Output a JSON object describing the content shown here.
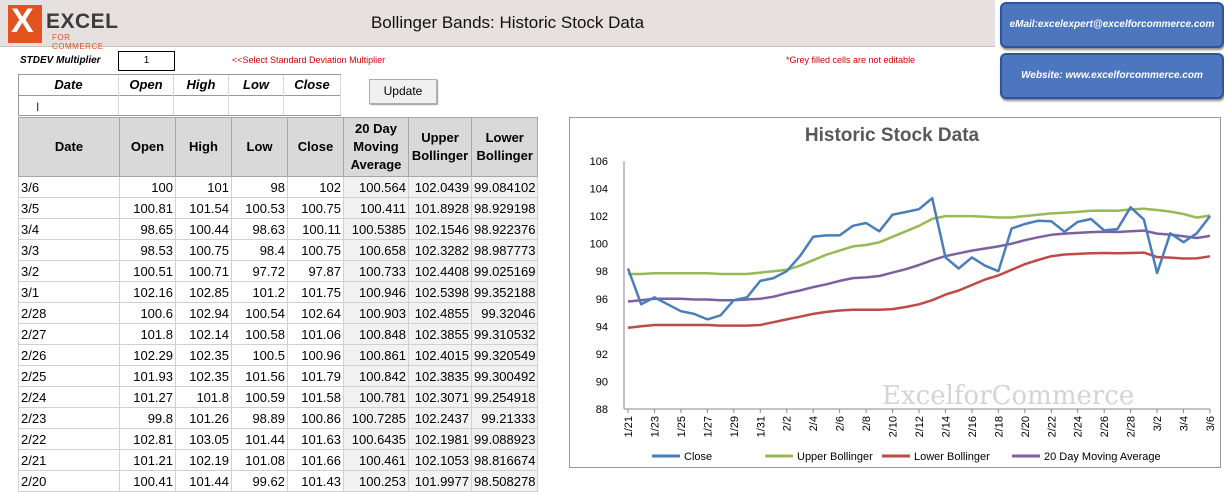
{
  "header": {
    "logo_word": "EXCEL",
    "logo_sub": "FOR COMMERCE",
    "logo_mark": "X",
    "title": "Bollinger Bands: Historic Stock Data",
    "email_button": "eMail:excelexpert@excelforcommerce.com",
    "website_button": "Website: www.excelforcommerce.com"
  },
  "controls": {
    "stdev_label": "STDEV Multiplier",
    "stdev_value": "1",
    "stdev_hint": "<<Select Standard Deviation Multiplier",
    "grey_note": "*Grey filled cells are not editable",
    "update_label": "Update",
    "cursor_glyph": "I"
  },
  "entry": {
    "headers": [
      "Date",
      "Open",
      "High",
      "Low",
      "Close"
    ]
  },
  "table": {
    "headers": [
      "Date",
      "Open",
      "High",
      "Low",
      "Close",
      "20 Day Moving Average",
      "Upper Bollinger",
      "Lower Bollinger"
    ],
    "rows": [
      [
        "3/6",
        "100",
        "101",
        "98",
        "102",
        "100.564",
        "102.0439",
        "99.084102"
      ],
      [
        "3/5",
        "100.81",
        "101.54",
        "100.53",
        "100.75",
        "100.411",
        "101.8928",
        "98.929198"
      ],
      [
        "3/4",
        "98.65",
        "100.44",
        "98.63",
        "100.11",
        "100.5385",
        "102.1546",
        "98.922376"
      ],
      [
        "3/3",
        "98.53",
        "100.75",
        "98.4",
        "100.75",
        "100.658",
        "102.3282",
        "98.987773"
      ],
      [
        "3/2",
        "100.51",
        "100.71",
        "97.72",
        "97.87",
        "100.733",
        "102.4408",
        "99.025169"
      ],
      [
        "3/1",
        "102.16",
        "102.85",
        "101.2",
        "101.75",
        "100.946",
        "102.5398",
        "99.352188"
      ],
      [
        "2/28",
        "100.6",
        "102.94",
        "100.54",
        "102.64",
        "100.903",
        "102.4855",
        "99.32046"
      ],
      [
        "2/27",
        "101.8",
        "102.14",
        "100.58",
        "101.06",
        "100.848",
        "102.3855",
        "99.310532"
      ],
      [
        "2/26",
        "102.29",
        "102.35",
        "100.5",
        "100.96",
        "100.861",
        "102.4015",
        "99.320549"
      ],
      [
        "2/25",
        "101.93",
        "102.35",
        "101.56",
        "101.79",
        "100.842",
        "102.3835",
        "99.300492"
      ],
      [
        "2/24",
        "101.27",
        "101.8",
        "100.59",
        "101.58",
        "100.781",
        "102.3071",
        "99.254918"
      ],
      [
        "2/23",
        "99.8",
        "101.26",
        "98.89",
        "100.86",
        "100.7285",
        "102.2437",
        "99.21333"
      ],
      [
        "2/22",
        "102.81",
        "103.05",
        "101.44",
        "101.63",
        "100.6435",
        "102.1981",
        "99.088923"
      ],
      [
        "2/21",
        "101.21",
        "102.19",
        "101.08",
        "101.66",
        "100.461",
        "102.1053",
        "98.816674"
      ],
      [
        "2/20",
        "100.41",
        "101.44",
        "99.62",
        "101.43",
        "100.253",
        "101.9977",
        "98.508278"
      ]
    ]
  },
  "chart_data": {
    "type": "line",
    "title": "Historic Stock Data",
    "watermark": "ExcelforCommerce",
    "xlabel": "",
    "ylabel": "",
    "ylim": [
      88,
      106
    ],
    "yticks": [
      88,
      90,
      92,
      94,
      96,
      98,
      100,
      102,
      104,
      106
    ],
    "x_tick_labels": [
      "1/21",
      "1/23",
      "1/25",
      "1/27",
      "1/29",
      "1/31",
      "2/2",
      "2/4",
      "2/6",
      "2/8",
      "2/10",
      "2/12",
      "2/14",
      "2/16",
      "2/18",
      "2/20",
      "2/22",
      "2/24",
      "2/26",
      "2/28",
      "3/2",
      "3/4",
      "3/6"
    ],
    "x_dates": [
      "1/21",
      "1/22",
      "1/23",
      "1/24",
      "1/25",
      "1/26",
      "1/27",
      "1/28",
      "1/29",
      "1/30",
      "1/31",
      "2/1",
      "2/2",
      "2/3",
      "2/4",
      "2/5",
      "2/6",
      "2/7",
      "2/8",
      "2/9",
      "2/10",
      "2/11",
      "2/12",
      "2/13",
      "2/14",
      "2/15",
      "2/16",
      "2/17",
      "2/18",
      "2/19",
      "2/20",
      "2/21",
      "2/22",
      "2/23",
      "2/24",
      "2/25",
      "2/26",
      "2/27",
      "2/28",
      "3/1",
      "3/2",
      "3/3",
      "3/4",
      "3/5",
      "3/6"
    ],
    "legend_position": "bottom",
    "grid": false,
    "series": [
      {
        "name": "Close",
        "color": "#4a7ebb",
        "values": [
          98.2,
          95.6,
          96.1,
          95.6,
          95.1,
          94.9,
          94.5,
          94.8,
          95.9,
          96.1,
          97.3,
          97.5,
          98.0,
          99.1,
          100.5,
          100.6,
          100.6,
          101.3,
          101.5,
          100.9,
          102.1,
          102.3,
          102.5,
          103.3,
          99.0,
          98.2,
          99.0,
          98.4,
          98.0,
          101.1,
          101.43,
          101.66,
          101.63,
          100.86,
          101.58,
          101.79,
          100.96,
          101.06,
          102.64,
          101.75,
          97.87,
          100.75,
          100.11,
          100.75,
          102
        ]
      },
      {
        "name": "Upper Bollinger",
        "color": "#98b954",
        "values": [
          97.8,
          97.8,
          97.85,
          97.85,
          97.85,
          97.85,
          97.85,
          97.8,
          97.8,
          97.8,
          97.9,
          98.0,
          98.1,
          98.4,
          98.8,
          99.2,
          99.5,
          99.8,
          99.9,
          100.1,
          100.5,
          100.9,
          101.3,
          101.8,
          102.0,
          102.0,
          102.0,
          101.95,
          101.9,
          101.9,
          101.9977,
          102.1053,
          102.1981,
          102.2437,
          102.3071,
          102.3835,
          102.4015,
          102.3855,
          102.4855,
          102.5398,
          102.4408,
          102.3282,
          102.1546,
          101.8928,
          102.0439
        ]
      },
      {
        "name": "Lower Bollinger",
        "color": "#be4b48",
        "values": [
          93.9,
          94.0,
          94.1,
          94.1,
          94.1,
          94.1,
          94.1,
          94.05,
          94.05,
          94.05,
          94.1,
          94.3,
          94.5,
          94.7,
          94.9,
          95.05,
          95.15,
          95.2,
          95.2,
          95.2,
          95.25,
          95.4,
          95.6,
          95.9,
          96.3,
          96.6,
          97.0,
          97.4,
          97.7,
          98.1,
          98.508278,
          98.816674,
          99.088923,
          99.21333,
          99.254918,
          99.300492,
          99.320549,
          99.310532,
          99.32046,
          99.352188,
          99.025169,
          98.987773,
          98.922376,
          98.929198,
          99.084102
        ]
      },
      {
        "name": "20 Day Moving Average",
        "color": "#7d60a0",
        "values": [
          95.8,
          95.9,
          96.0,
          96.0,
          96.0,
          95.95,
          95.95,
          95.9,
          95.9,
          95.95,
          96.0,
          96.15,
          96.4,
          96.6,
          96.85,
          97.05,
          97.3,
          97.5,
          97.55,
          97.65,
          97.9,
          98.15,
          98.45,
          98.8,
          99.1,
          99.3,
          99.5,
          99.65,
          99.8,
          100.0,
          100.253,
          100.461,
          100.6435,
          100.7285,
          100.781,
          100.842,
          100.861,
          100.848,
          100.903,
          100.946,
          100.733,
          100.658,
          100.5385,
          100.411,
          100.564
        ]
      }
    ]
  }
}
